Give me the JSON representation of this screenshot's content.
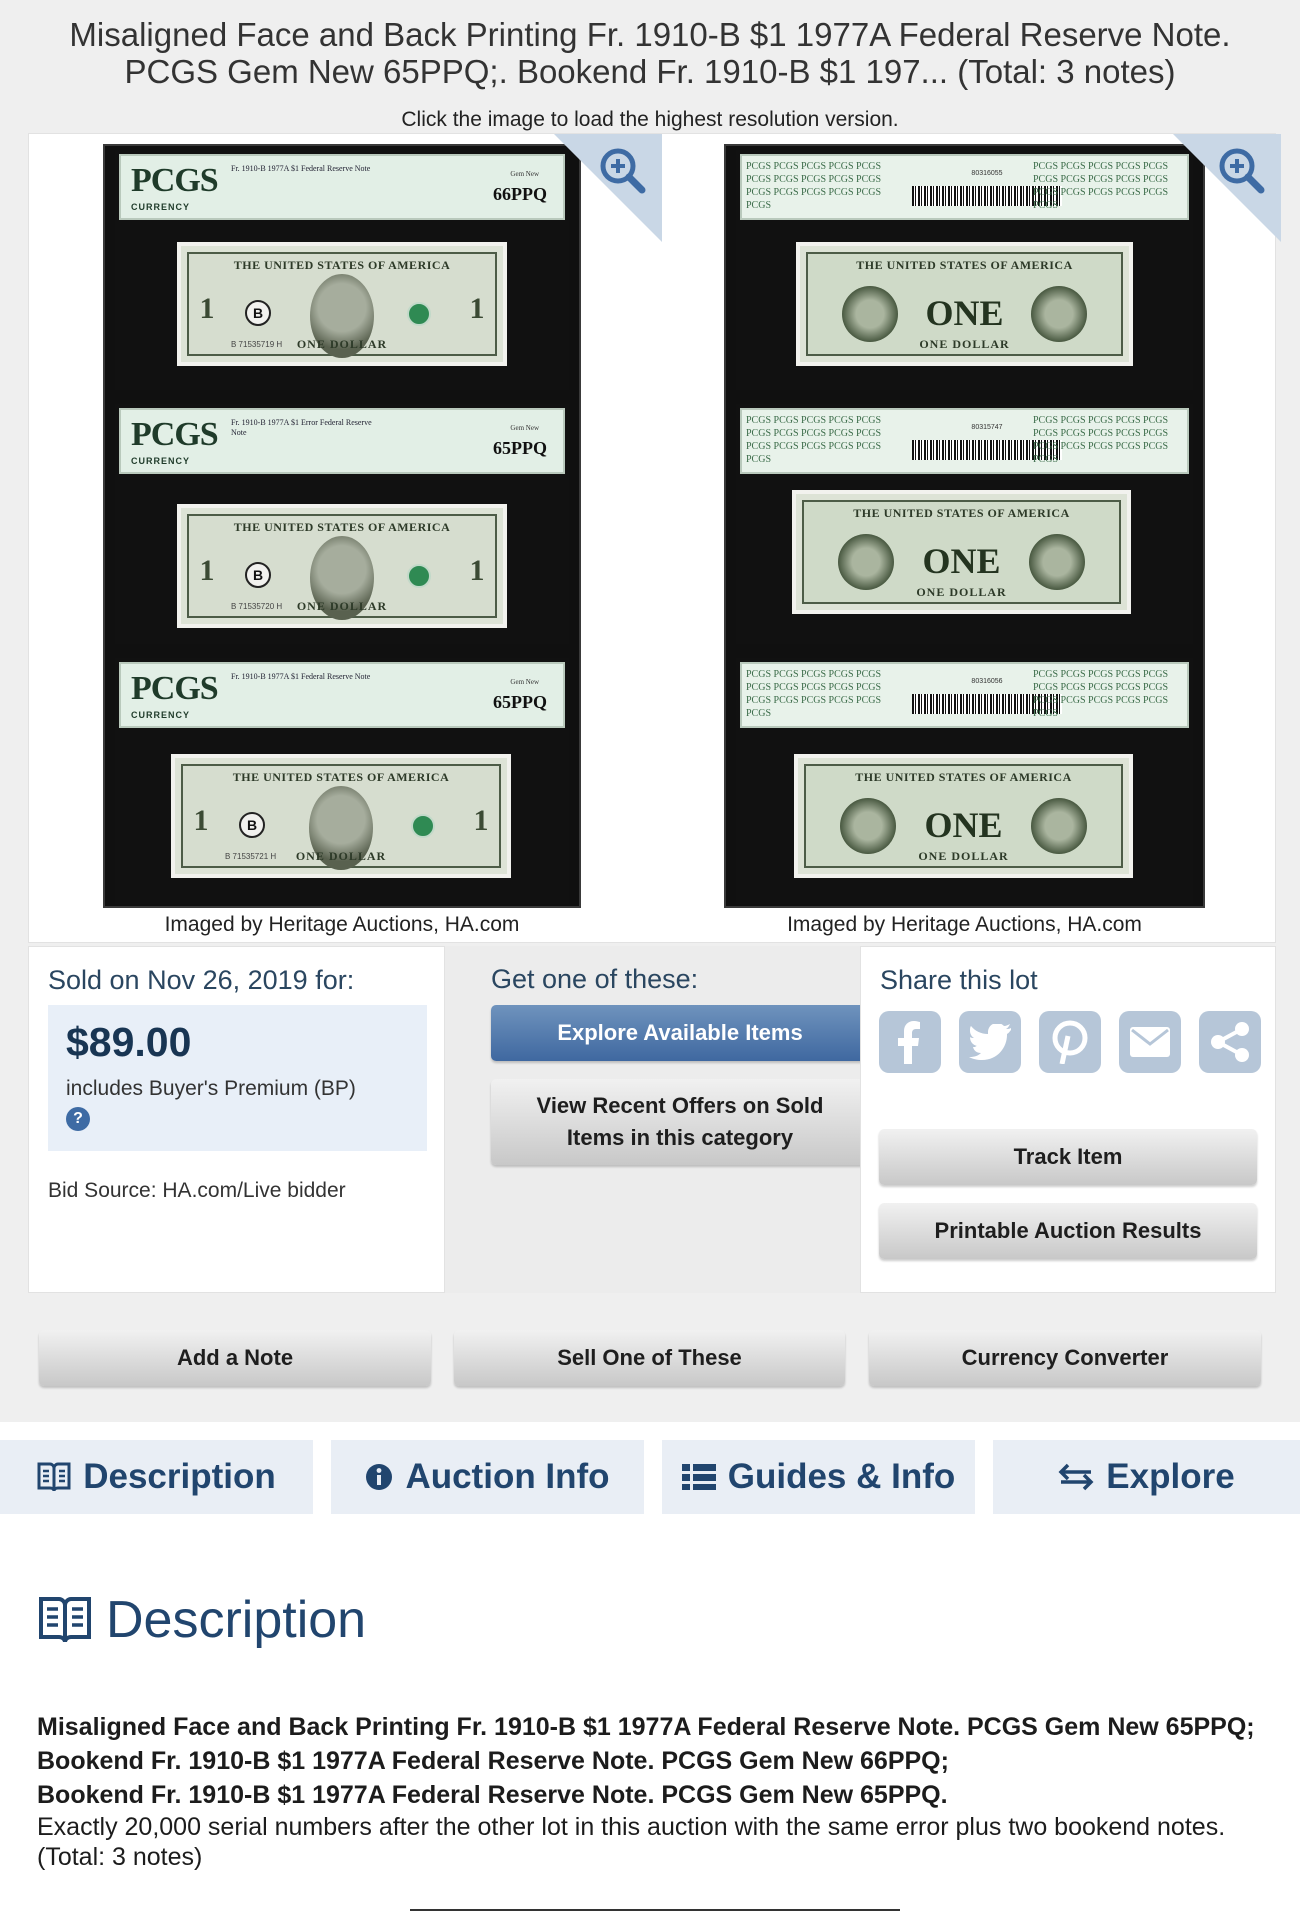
{
  "title": "Misaligned Face and Back Printing Fr. 1910-B $1 1977A Federal Reserve Note. PCGS Gem New 65PPQ;. Bookend Fr. 1910-B $1 197... (Total: 3 notes)",
  "hint": "Click the image to load the highest resolution version.",
  "images": {
    "credit_left": "Imaged by Heritage Auctions, HA.com",
    "credit_right": "Imaged by Heritage Auctions, HA.com",
    "slab_brand": "PCGS",
    "slab_brand_sub": "CURRENCY",
    "note_header": "THE UNITED STATES OF AMERICA",
    "note_footer": "ONE DOLLAR",
    "note_back_word": "ONE",
    "district_letter": "B",
    "slabs": [
      {
        "desc": "Fr. 1910-B 1977A $1 Federal Reserve Note",
        "grade": "66PPQ",
        "grade_title": "Gem New",
        "serial": "B 71535719 H",
        "barcode_no": "80316055"
      },
      {
        "desc": "Fr. 1910-B 1977A $1 Error Federal Reserve Note",
        "grade": "65PPQ",
        "grade_title": "Gem New",
        "serial": "B 71535720 H",
        "barcode_no": "80315747"
      },
      {
        "desc": "Fr. 1910-B 1977A $1 Federal Reserve Note",
        "grade": "65PPQ",
        "grade_title": "Gem New",
        "serial": "B 71535721 H",
        "barcode_no": "80316056"
      }
    ]
  },
  "sold": {
    "heading": "Sold on Nov 26, 2019 for:",
    "price": "$89.00",
    "premium_note": "includes Buyer's Premium (BP)",
    "help_glyph": "?",
    "bid_source": "Bid Source: HA.com/Live bidder"
  },
  "get": {
    "heading": "Get one of these:",
    "explore_label": "Explore Available Items",
    "offers_label": "View Recent Offers on Sold Items in this category"
  },
  "share": {
    "heading": "Share this lot",
    "icons": [
      "facebook-icon",
      "twitter-icon",
      "pinterest-icon",
      "email-icon",
      "share-icon"
    ],
    "track_label": "Track Item",
    "print_label": "Printable Auction Results"
  },
  "actions": {
    "add_note": "Add a Note",
    "sell": "Sell One of These",
    "currency": "Currency Converter"
  },
  "tabs": [
    {
      "label": "Description",
      "icon": "book-icon"
    },
    {
      "label": "Auction Info",
      "icon": "info-icon"
    },
    {
      "label": "Guides & Info",
      "icon": "list-icon"
    },
    {
      "label": "Explore",
      "icon": "exchange-icon"
    }
  ],
  "description": {
    "heading": "Description",
    "line1": "Misaligned Face and Back Printing Fr. 1910-B $1 1977A Federal Reserve Note. PCGS Gem New 65PPQ;",
    "line2": "Bookend Fr. 1910-B $1 1977A Federal Reserve Note. PCGS Gem New 66PPQ;",
    "line3": "Bookend Fr. 1910-B $1 1977A Federal Reserve Note. PCGS Gem New 65PPQ.",
    "body": "Exactly 20,000 serial numbers after the other lot in this auction with the same error plus two bookend notes. (Total: 3 notes)"
  },
  "colors": {
    "accent": "#21456e",
    "button_blue": "#3f68a0",
    "share_icon_bg": "#b6c6d8",
    "price_box": "#e8eff8"
  }
}
